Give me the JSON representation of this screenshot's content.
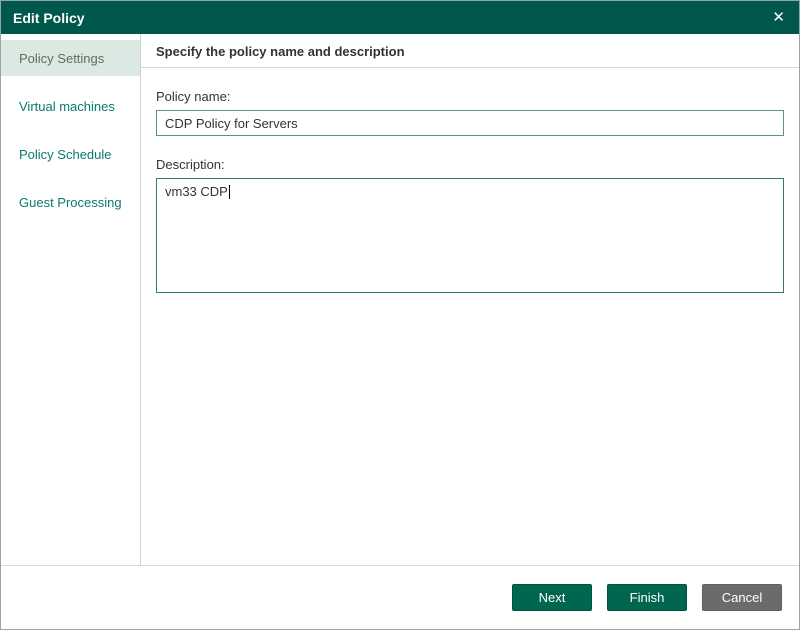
{
  "window": {
    "title": "Edit Policy",
    "close_icon": "✕"
  },
  "sidebar": {
    "items": [
      {
        "label": "Policy Settings",
        "active": true
      },
      {
        "label": "Virtual machines",
        "active": false
      },
      {
        "label": "Policy Schedule",
        "active": false
      },
      {
        "label": "Guest Processing",
        "active": false
      }
    ]
  },
  "content": {
    "heading": "Specify the policy name and description",
    "policy_name_label": "Policy name:",
    "policy_name_value": "CDP Policy for Servers",
    "description_label": "Description:",
    "description_value": "vm33 CDP"
  },
  "footer": {
    "next_label": "Next",
    "finish_label": "Finish",
    "cancel_label": "Cancel"
  },
  "colors": {
    "titlebar": "#00574b",
    "accent_green": "#00664f",
    "cancel_gray": "#6b6b6b",
    "sidebar_active_bg": "#dce8e2",
    "sidebar_link": "#0b7a6b",
    "input_border": "#5b9383"
  }
}
